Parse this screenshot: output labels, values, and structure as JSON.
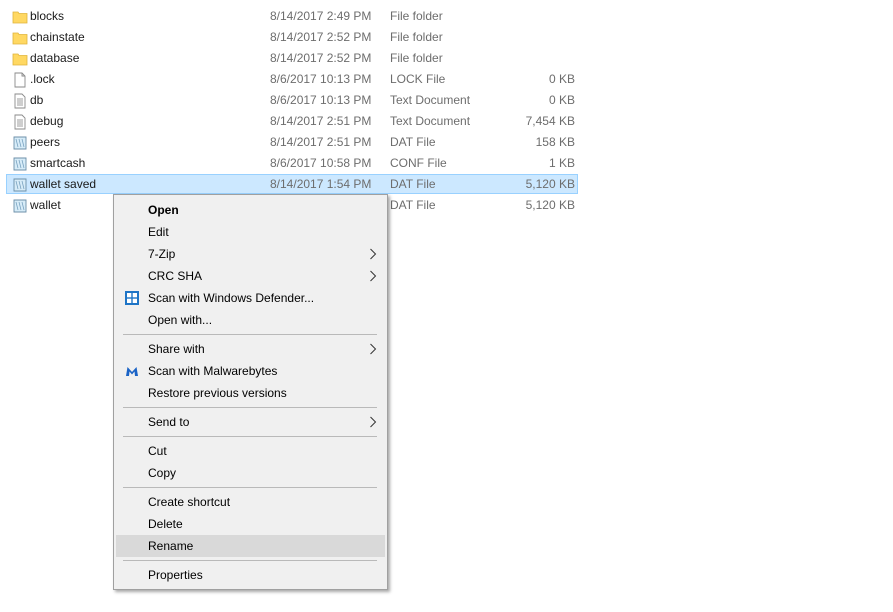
{
  "files": [
    {
      "name": "blocks",
      "date": "8/14/2017 2:49 PM",
      "type": "File folder",
      "size": "",
      "icon": "folder-icon"
    },
    {
      "name": "chainstate",
      "date": "8/14/2017 2:52 PM",
      "type": "File folder",
      "size": "",
      "icon": "folder-icon"
    },
    {
      "name": "database",
      "date": "8/14/2017 2:52 PM",
      "type": "File folder",
      "size": "",
      "icon": "folder-icon"
    },
    {
      "name": ".lock",
      "date": "8/6/2017 10:13 PM",
      "type": "LOCK File",
      "size": "0 KB",
      "icon": "blank-file-icon"
    },
    {
      "name": "db",
      "date": "8/6/2017 10:13 PM",
      "type": "Text Document",
      "size": "0 KB",
      "icon": "text-file-icon"
    },
    {
      "name": "debug",
      "date": "8/14/2017 2:51 PM",
      "type": "Text Document",
      "size": "7,454 KB",
      "icon": "text-file-icon"
    },
    {
      "name": "peers",
      "date": "8/14/2017 2:51 PM",
      "type": "DAT File",
      "size": "158 KB",
      "icon": "data-file-icon"
    },
    {
      "name": "smartcash",
      "date": "8/6/2017 10:58 PM",
      "type": "CONF File",
      "size": "1 KB",
      "icon": "data-file-icon"
    },
    {
      "name": "wallet saved",
      "date": "8/14/2017 1:54 PM",
      "type": "DAT File",
      "size": "5,120 KB",
      "icon": "data-file-icon"
    },
    {
      "name": "wallet",
      "date": "",
      "type": "DAT File",
      "size": "5,120 KB",
      "icon": "data-file-icon"
    }
  ],
  "selected_file": "wallet saved",
  "context_menu": {
    "open": "Open",
    "edit": "Edit",
    "seven_zip": "7-Zip",
    "crc_sha": "CRC SHA",
    "scan_defender": "Scan with Windows Defender...",
    "open_with": "Open with...",
    "share_with": "Share with",
    "scan_malwarebytes": "Scan with Malwarebytes",
    "restore_previous": "Restore previous versions",
    "send_to": "Send to",
    "cut": "Cut",
    "copy": "Copy",
    "create_shortcut": "Create shortcut",
    "delete": "Delete",
    "rename": "Rename",
    "properties": "Properties",
    "highlighted_item": "Rename"
  },
  "colors": {
    "selection_bg": "#cce8ff",
    "selection_border": "#99d1ff",
    "menu_bg": "#f0f0f0",
    "menu_hover": "#d9d9d9",
    "folder": "#ffd862",
    "defender_blue": "#1e74c6",
    "malwarebytes_blue": "#1a63c6"
  }
}
